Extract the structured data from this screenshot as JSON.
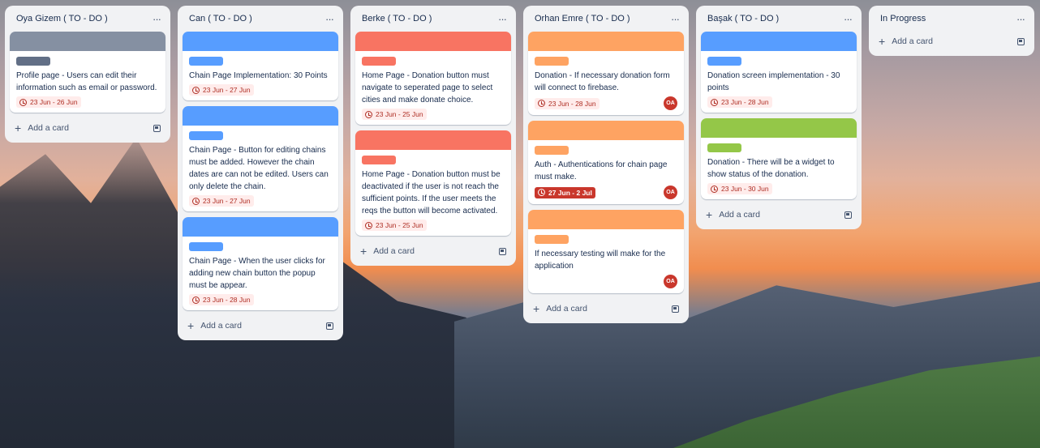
{
  "colors": {
    "gray": "#8590a2",
    "gray_label": "#626f86",
    "blue": "#579dff",
    "red": "#f87462",
    "orange": "#fea362",
    "green": "#94c748"
  },
  "icons": {
    "more": "more-icon",
    "clock": "clock-icon",
    "plus": "plus-icon",
    "template": "card-template-icon"
  },
  "common": {
    "add_card": "Add a card",
    "more": "···",
    "plus": "+"
  },
  "lists": [
    {
      "title": "Oya Gizem ( TO - DO )",
      "cards": [
        {
          "text": "Profile page - Users can edit their information such as email or password.",
          "due": "23 Jun - 26 Jun"
        }
      ]
    },
    {
      "title": "Can ( TO - DO )",
      "cards": [
        {
          "text": "Chain Page Implementation: 30 Points",
          "due": "23 Jun - 27 Jun"
        },
        {
          "text": "Chain Page - Button for editing chains must be added. However the chain dates are can not be edited. Users can only delete the chain.",
          "due": "23 Jun - 27 Jun"
        },
        {
          "text": "Chain Page - When the user clicks for adding new chain button the popup must be appear.",
          "due": "23 Jun - 28 Jun"
        }
      ]
    },
    {
      "title": "Berke ( TO - DO )",
      "cards": [
        {
          "text": "Home Page - Donation button must navigate to seperated page to select cities and make donate choice.",
          "due": "23 Jun - 25 Jun"
        },
        {
          "text": "Home Page - Donation button must be deactivated if the user is not reach the sufficient points. If the user meets the reqs the button will become activated.",
          "due": "23 Jun - 25 Jun"
        }
      ]
    },
    {
      "title": "Orhan Emre ( TO - DO )",
      "cards": [
        {
          "text": "Donation - If necessary donation form will connect to firebase.",
          "due": "23 Jun - 28 Jun",
          "avatar": "OA"
        },
        {
          "text": "Auth - Authentications for chain page must make.",
          "due": "27 Jun - 2 Jul",
          "avatar": "OA"
        },
        {
          "text": "If necessary testing will make for the application",
          "avatar": "OA"
        }
      ]
    },
    {
      "title": "Başak ( TO - DO )",
      "cards": [
        {
          "text": "Donation screen implementation - 30 points",
          "due": "23 Jun - 28 Jun"
        },
        {
          "text": "Donation - There will be a widget to show status of the donation.",
          "due": "23 Jun - 30 Jun"
        }
      ]
    },
    {
      "title": "In Progress",
      "cards": []
    }
  ]
}
